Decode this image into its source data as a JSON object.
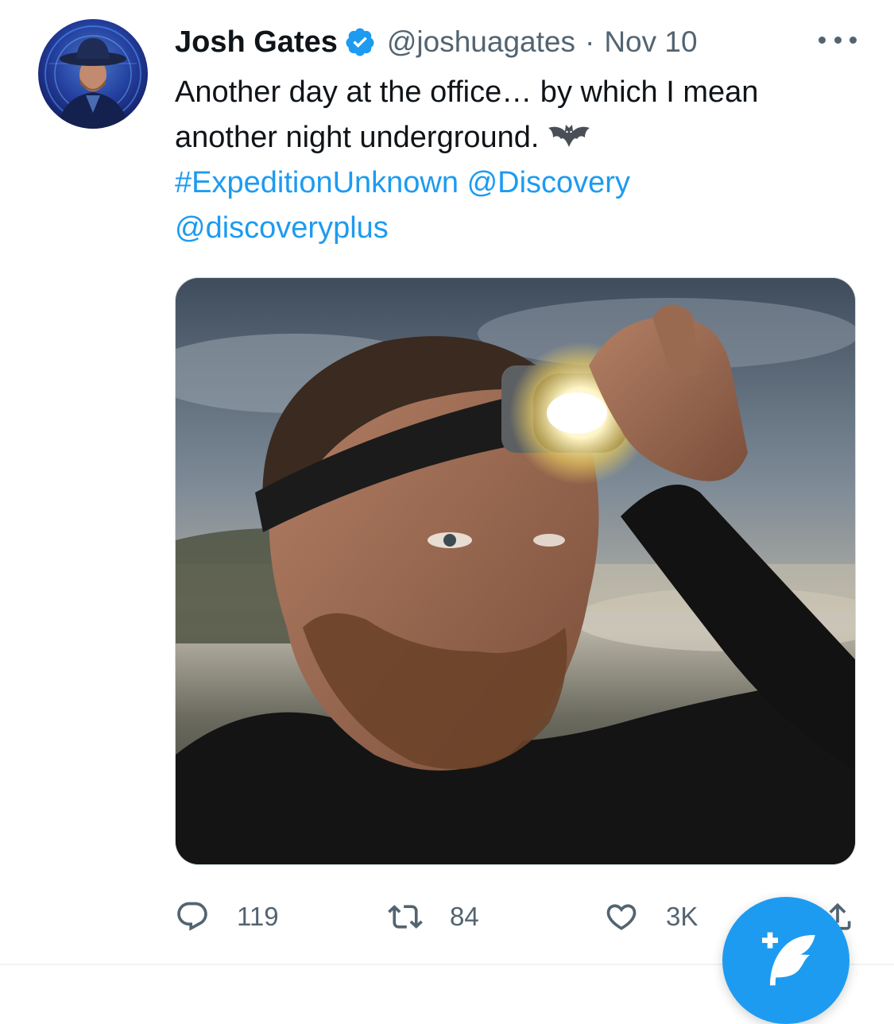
{
  "tweet": {
    "author_name": "Josh Gates",
    "handle": "@joshuagates",
    "separator": "·",
    "date": "Nov 10",
    "text_line1": "Another day at the office… by which I mean",
    "text_line2": "another night underground.",
    "emoji": "bat-emoji",
    "hashtag": "#ExpeditionUnknown",
    "mention1": "@Discovery",
    "mention2": "@discoveryplus",
    "media_description_icon": "photo"
  },
  "actions": {
    "reply_count": "119",
    "retweet_count": "84",
    "like_count": "3K"
  },
  "icons": {
    "verified": "verified-badge-icon",
    "more": "more-options-icon",
    "reply": "reply-icon",
    "retweet": "retweet-icon",
    "like": "heart-icon",
    "share": "share-icon",
    "compose": "compose-tweet-icon"
  },
  "colors": {
    "accent": "#1d9bf0",
    "text": "#0f1419",
    "muted": "#536471",
    "border": "#eff3f4"
  }
}
